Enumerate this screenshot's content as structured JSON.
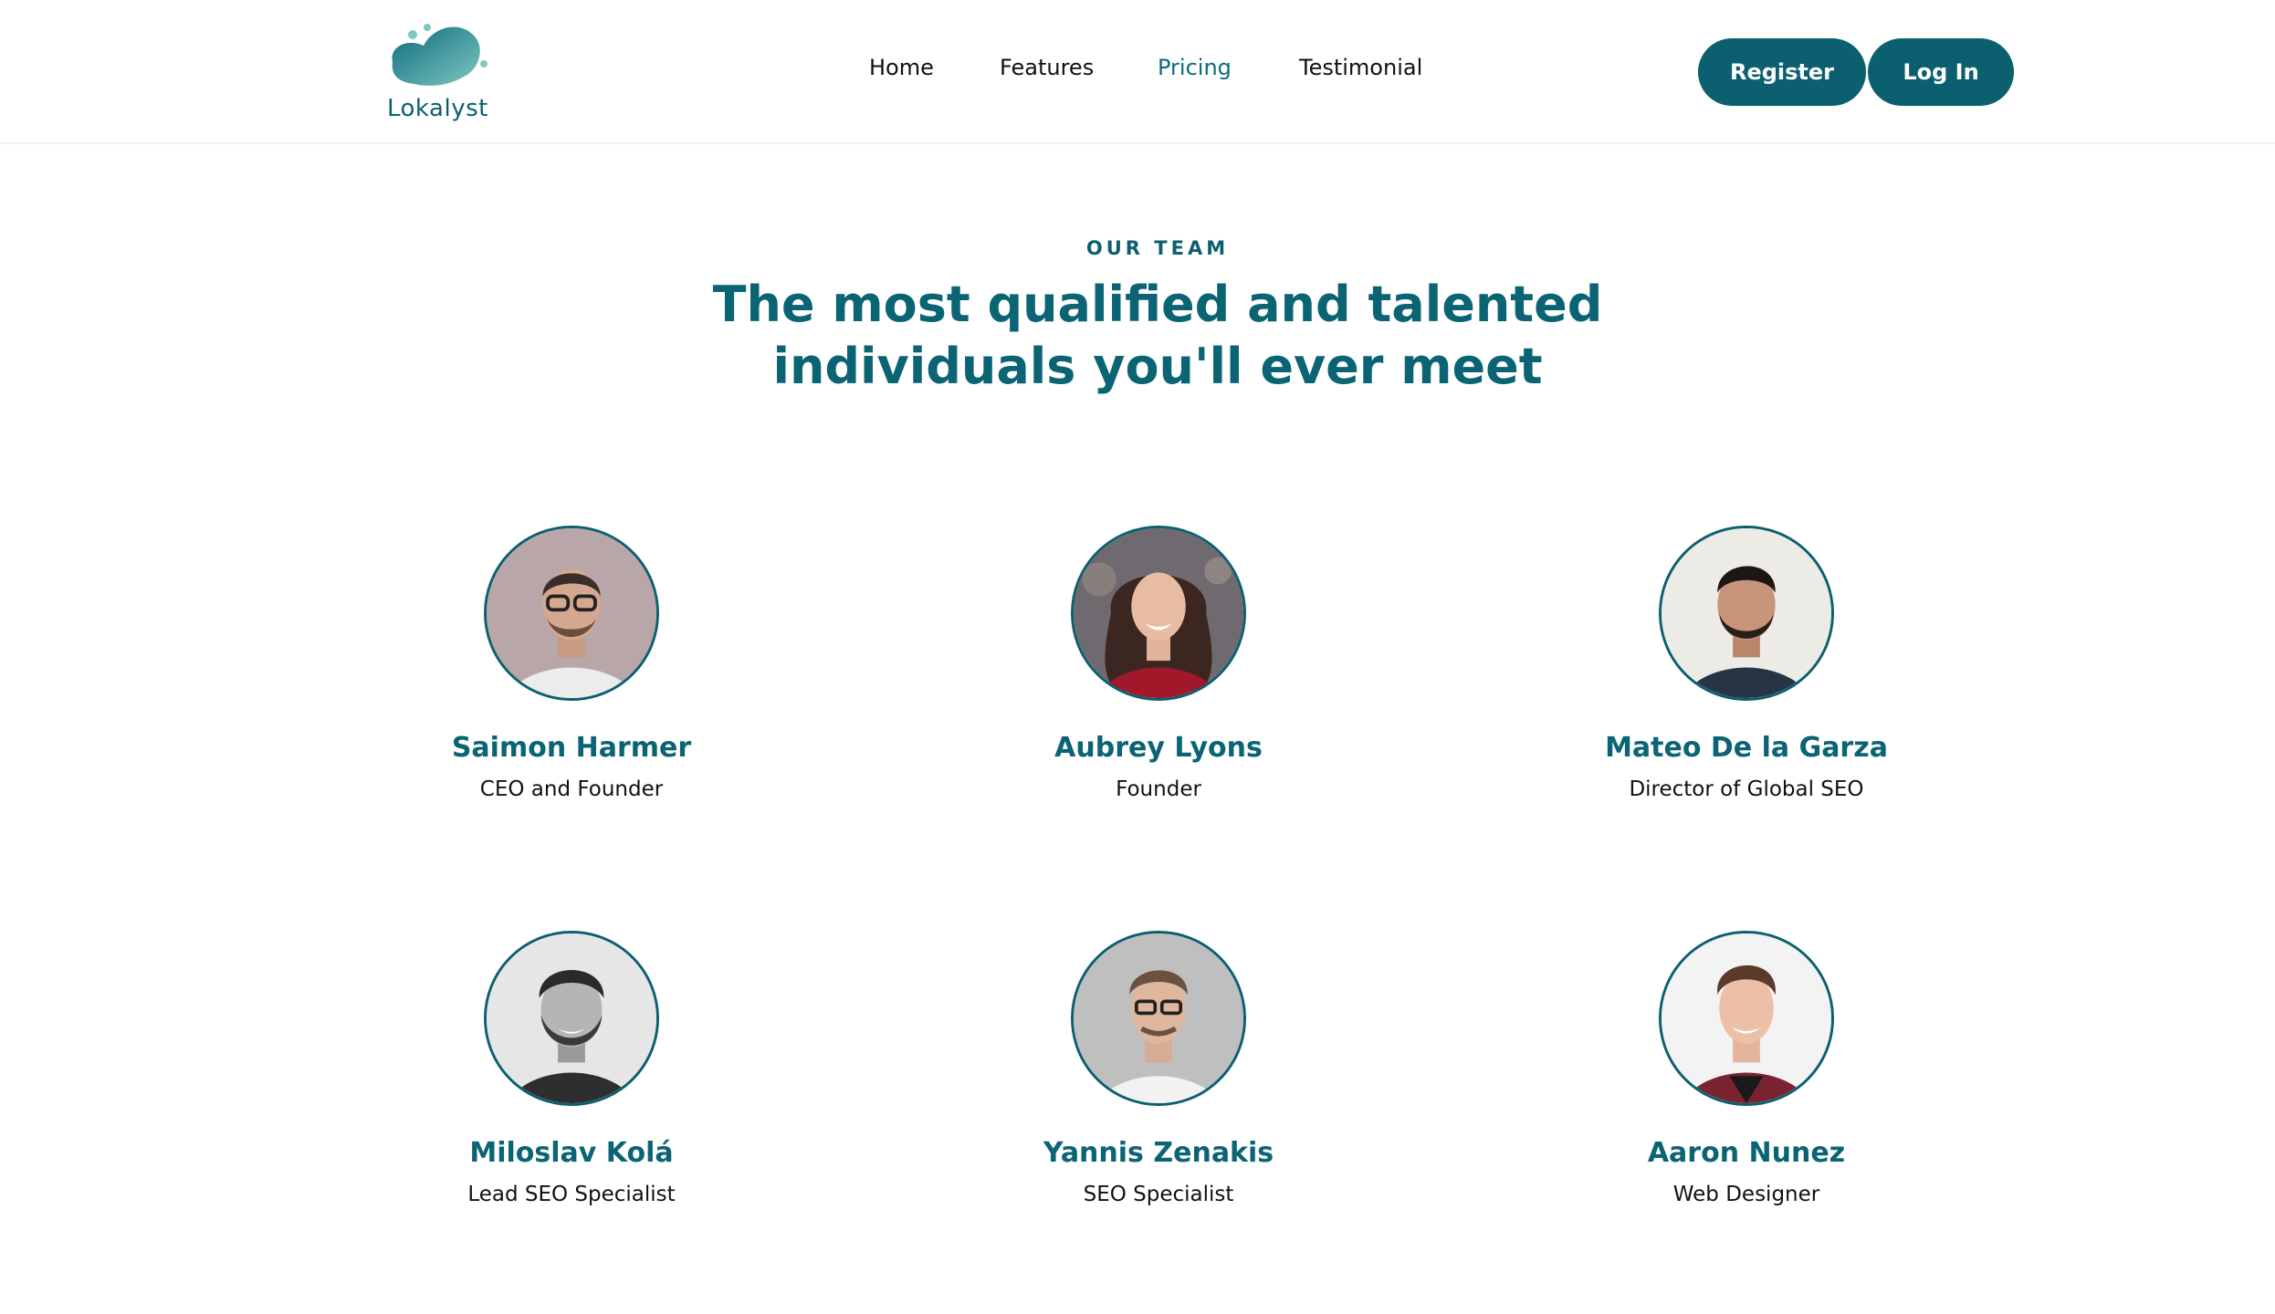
{
  "brand": {
    "name": "Lokalyst",
    "color": "#0b5f6f"
  },
  "nav": {
    "items": [
      {
        "label": "Home",
        "active": false
      },
      {
        "label": "Features",
        "active": false
      },
      {
        "label": "Pricing",
        "active": true
      },
      {
        "label": "Testimonial",
        "active": false
      }
    ]
  },
  "auth": {
    "register_label": "Register",
    "login_label": "Log In"
  },
  "section": {
    "eyebrow": "OUR TEAM",
    "title_line1": "The most qualified and talented",
    "title_line2": "individuals you'll ever meet"
  },
  "team": [
    {
      "name": "Saimon Harmer",
      "role": "CEO and Founder",
      "icon": "avatar-photo"
    },
    {
      "name": "Aubrey Lyons",
      "role": "Founder",
      "icon": "avatar-photo"
    },
    {
      "name": "Mateo De la Garza",
      "role": "Director of Global SEO",
      "icon": "avatar-photo"
    },
    {
      "name": "Miloslav Kolá",
      "role": "Lead SEO Specialist",
      "icon": "avatar-photo"
    },
    {
      "name": "Yannis Zenakis",
      "role": "SEO Specialist",
      "icon": "avatar-photo"
    },
    {
      "name": "Aaron Nunez",
      "role": "Web Designer",
      "icon": "avatar-photo"
    }
  ]
}
